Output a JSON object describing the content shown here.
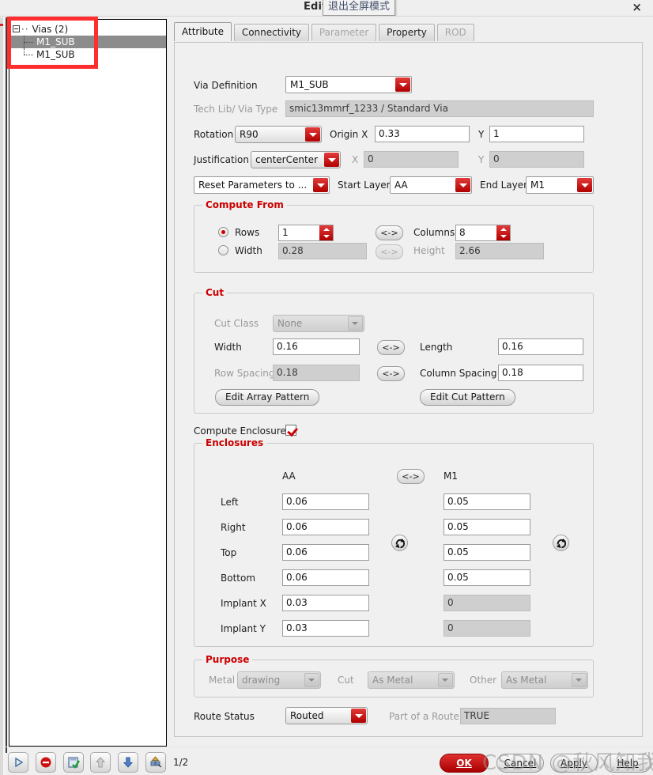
{
  "window": {
    "title": "Edit Via",
    "tooltip": "退出全屏模式",
    "close_icon": "×"
  },
  "tree": {
    "root_label": "Vias (2)",
    "items": [
      {
        "label": "M1_SUB",
        "selected": true
      },
      {
        "label": "M1_SUB",
        "selected": false
      }
    ]
  },
  "tabs": [
    {
      "label": "Attribute",
      "active": true,
      "disabled": false
    },
    {
      "label": "Connectivity",
      "active": false,
      "disabled": false
    },
    {
      "label": "Parameter",
      "active": false,
      "disabled": true
    },
    {
      "label": "Property",
      "active": false,
      "disabled": false
    },
    {
      "label": "ROD",
      "active": false,
      "disabled": true
    }
  ],
  "attribute": {
    "via_definition_label": "Via Definition",
    "via_definition_value": "M1_SUB",
    "tech_lib_label": "Tech Lib/ Via Type",
    "tech_lib_value": "smic13mmrf_1233 / Standard Via",
    "rotation_label": "Rotation",
    "rotation_value": "R90",
    "origin_x_label": "Origin X",
    "origin_x_value": "0.33",
    "origin_y_label": "Y",
    "origin_y_value": "1",
    "justification_label": "Justification",
    "justification_value": "centerCenter",
    "just_x_label": "X",
    "just_x_value": "0",
    "just_y_label": "Y",
    "just_y_value": "0",
    "reset_params_value": "Reset Parameters to ...",
    "start_layer_label": "Start Layer",
    "start_layer_value": "AA",
    "end_layer_label": "End Layer",
    "end_layer_value": "M1"
  },
  "compute_from": {
    "title": "Compute From",
    "rows_label": "Rows",
    "rows_value": "1",
    "rows_selected": true,
    "width_label": "Width",
    "width_value": "0.28",
    "width_selected": false,
    "columns_label": "Columns",
    "columns_value": "8",
    "height_label": "Height",
    "height_value": "2.66",
    "swap_label": "<->"
  },
  "cut": {
    "title": "Cut",
    "cut_class_label": "Cut Class",
    "cut_class_value": "None",
    "width_label": "Width",
    "width_value": "0.16",
    "length_label": "Length",
    "length_value": "0.16",
    "row_spacing_label": "Row Spacing",
    "row_spacing_value": "0.18",
    "column_spacing_label": "Column Spacing",
    "column_spacing_value": "0.18",
    "edit_array_pattern": "Edit Array Pattern",
    "edit_cut_pattern": "Edit Cut Pattern",
    "swap_label": "<->"
  },
  "enclosures": {
    "compute_label": "Compute Enclosures",
    "compute_checked": true,
    "title": "Enclosures",
    "col_left_header": "AA",
    "col_right_header": "M1",
    "swap_label": "<->",
    "rows": [
      {
        "label": "Left",
        "left": "0.06",
        "right": "0.05",
        "right_readonly": false
      },
      {
        "label": "Right",
        "left": "0.06",
        "right": "0.05",
        "right_readonly": false
      },
      {
        "label": "Top",
        "left": "0.06",
        "right": "0.05",
        "right_readonly": false
      },
      {
        "label": "Bottom",
        "left": "0.06",
        "right": "0.05",
        "right_readonly": false
      },
      {
        "label": "Implant X",
        "left": "0.03",
        "right": "0",
        "right_readonly": true
      },
      {
        "label": "Implant Y",
        "left": "0.03",
        "right": "0",
        "right_readonly": true
      }
    ]
  },
  "purpose": {
    "title": "Purpose",
    "metal_label": "Metal",
    "metal_value": "drawing",
    "cut_label": "Cut",
    "cut_value": "As Metal",
    "other_label": "Other",
    "other_value": "As Metal"
  },
  "route": {
    "status_label": "Route Status",
    "status_value": "Routed",
    "part_label": "Part of a Route",
    "part_value": "TRUE"
  },
  "statusbar": {
    "page": "1/2",
    "icons": [
      "play-icon",
      "stop-icon",
      "save-check-icon",
      "arrow-up-icon",
      "arrow-down-icon",
      "settings-icon"
    ]
  },
  "actions": {
    "ok": "OK",
    "cancel": "Cancel",
    "apply": "Apply",
    "help": "Help"
  },
  "watermark": "CSDN @秋风知我意",
  "colors": {
    "accent_red": "#cc0000",
    "group_title": "#cc0000",
    "annotation": "#ff2d2d",
    "selection": "#8c8c8c"
  }
}
